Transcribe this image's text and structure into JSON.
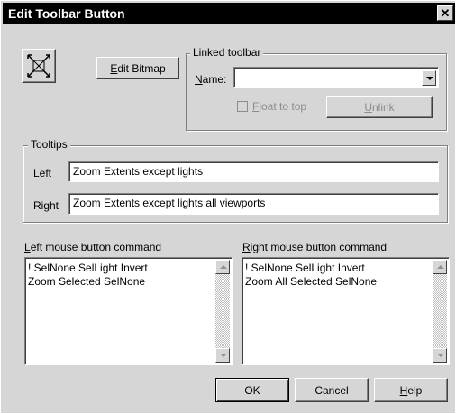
{
  "window": {
    "title": "Edit Toolbar Button",
    "close_glyph": "✕"
  },
  "icon_button": {
    "icon": "zoom-extents-icon"
  },
  "edit_bitmap": {
    "mnemonic": "E",
    "rest": "dit Bitmap"
  },
  "linked_toolbar": {
    "legend": "Linked toolbar",
    "name_mnemonic": "N",
    "name_rest": "ame:",
    "name_value": "",
    "float_mnemonic": "F",
    "float_rest": "loat to top",
    "float_checked": false,
    "unlink_mnemonic": "U",
    "unlink_rest": "nlink"
  },
  "tooltips": {
    "legend": "Tooltips",
    "left_label": "Left",
    "left_value": "Zoom Extents except lights",
    "right_label": "Right",
    "right_value": "Zoom Extents except lights all viewports"
  },
  "left_command": {
    "label_mnemonic": "L",
    "label_rest": "eft mouse button command",
    "lines": [
      "! SelNone SelLight Invert",
      "Zoom Selected SelNone"
    ]
  },
  "right_command": {
    "label_mnemonic": "R",
    "label_rest": "ight mouse button command",
    "lines": [
      "! SelNone SelLight Invert",
      "Zoom All Selected SelNone"
    ]
  },
  "buttons": {
    "ok": "OK",
    "cancel": "Cancel",
    "help_mnemonic": "H",
    "help_rest": "elp"
  },
  "colors": {
    "titlebar": "#000000",
    "face": "#d6d6d6",
    "disabled_text": "#8c8c8c"
  }
}
